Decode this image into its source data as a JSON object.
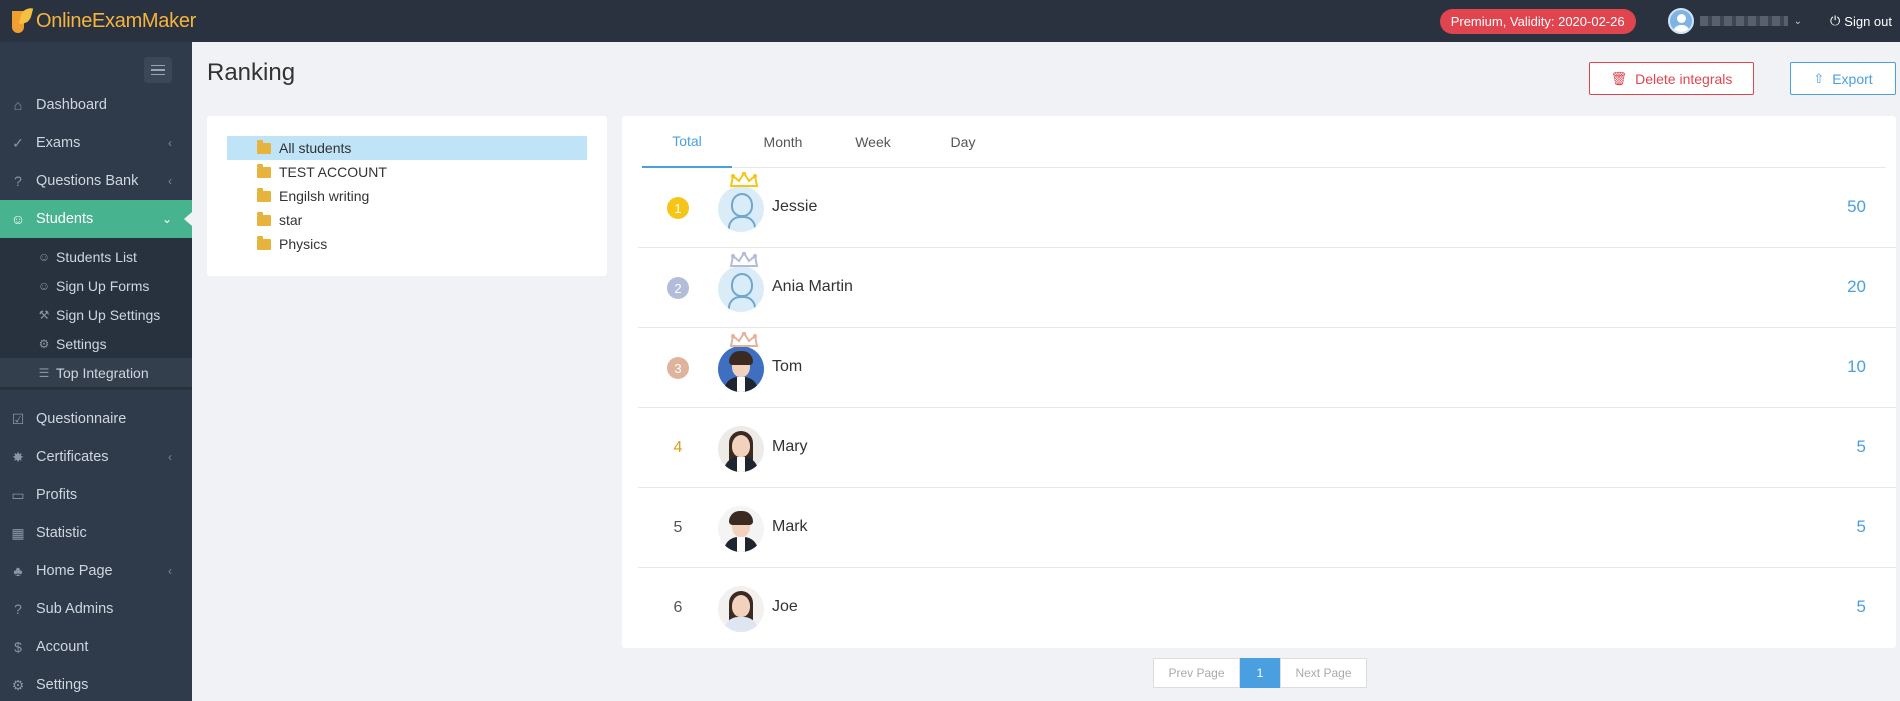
{
  "app": {
    "logo_text": "OnlineExamMaker",
    "premium_badge": "Premium, Validity: 2020-02-26",
    "signout_label": "Sign out"
  },
  "sidebar": {
    "items": [
      {
        "label": "Dashboard",
        "icon": "home-icon"
      },
      {
        "label": "Exams",
        "icon": "check-circle-icon",
        "has_chevron": true
      },
      {
        "label": "Questions Bank",
        "icon": "question-circle-icon",
        "has_chevron": true
      },
      {
        "label": "Students",
        "icon": "users-icon",
        "active": true
      },
      {
        "label": "Questionnaire",
        "icon": "checkbox-icon"
      },
      {
        "label": "Certificates",
        "icon": "badge-icon",
        "has_chevron": true
      },
      {
        "label": "Profits",
        "icon": "credit-card-icon"
      },
      {
        "label": "Statistic",
        "icon": "bar-chart-icon"
      },
      {
        "label": "Home Page",
        "icon": "home-page-icon",
        "has_chevron": true
      },
      {
        "label": "Sub Admins",
        "icon": "question-circle-icon"
      },
      {
        "label": "Account",
        "icon": "dollar-icon"
      },
      {
        "label": "Settings",
        "icon": "gear-icon"
      }
    ],
    "sub_items": [
      {
        "label": "Students List",
        "icon": "user-icon"
      },
      {
        "label": "Sign Up Forms",
        "icon": "user-plus-icon"
      },
      {
        "label": "Sign Up Settings",
        "icon": "wrench-icon"
      },
      {
        "label": "Settings",
        "icon": "gear-icon"
      },
      {
        "label": "Top Integration",
        "icon": "list-icon",
        "active": true
      }
    ]
  },
  "header": {
    "title": "Ranking",
    "delete_label": "Delete integrals",
    "export_label": "Export"
  },
  "groups": [
    {
      "label": "All students",
      "selected": true
    },
    {
      "label": "TEST ACCOUNT"
    },
    {
      "label": "Engilsh writing"
    },
    {
      "label": "star"
    },
    {
      "label": "Physics"
    }
  ],
  "tabs": [
    {
      "label": "Total",
      "active": true
    },
    {
      "label": "Month"
    },
    {
      "label": "Week"
    },
    {
      "label": "Day"
    }
  ],
  "ranking": [
    {
      "rank": "1",
      "name": "Jessie",
      "score": "50",
      "medal_color": "#f5c518",
      "crown_color": "#f5c518",
      "avatar": "placeholder"
    },
    {
      "rank": "2",
      "name": "Ania Martin",
      "score": "20",
      "medal_color": "#b3bcd8",
      "crown_color": "#b3bcd8",
      "avatar": "placeholder"
    },
    {
      "rank": "3",
      "name": "Tom",
      "score": "10",
      "medal_color": "#e0b49c",
      "crown_color": "#e0b49c",
      "avatar": "photo-boy"
    },
    {
      "rank": "4",
      "name": "Mary",
      "score": "5",
      "avatar": "photo-girl"
    },
    {
      "rank": "5",
      "name": "Mark",
      "score": "5",
      "avatar": "photo-dark"
    },
    {
      "rank": "6",
      "name": "Joe",
      "score": "5",
      "avatar": "photo-girl-light"
    }
  ],
  "pagination": {
    "prev_label": "Prev Page",
    "current_page": "1",
    "next_label": "Next Page"
  },
  "colors": {
    "accent": "#4a9fe0",
    "active_nav": "#47b38f",
    "danger": "#e0454f",
    "topbar": "#2a3240",
    "sidebar": "#2f3a4a"
  }
}
